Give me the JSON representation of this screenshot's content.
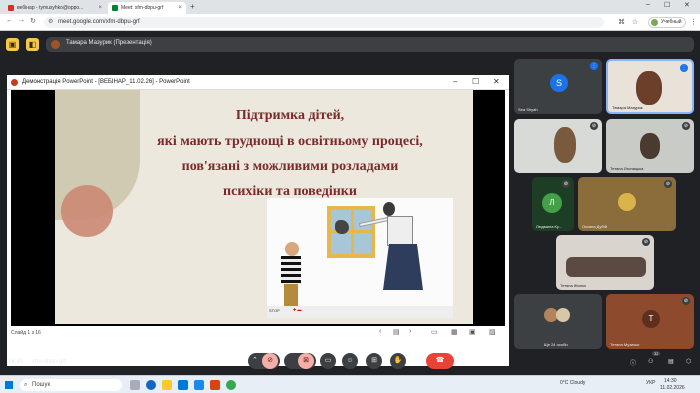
{
  "browser": {
    "tabs": [
      {
        "label": "вебінар - tymusyhko@oppo...",
        "active": false
      },
      {
        "label": "Meet: xfm-dbpu-grf",
        "active": true
      }
    ],
    "new_tab": "+",
    "url": "meet.google.com/xfm-dbpu-grf",
    "profile_label": "Учебный"
  },
  "meet": {
    "presenter_bar": "Тамара Мазурик (Презентація)",
    "meeting_time": "14:30",
    "meeting_code": "xfm-dbpu-grf",
    "participants_count": "32"
  },
  "powerpoint": {
    "window_title": "Демонстрація PowerPoint - [ВЕБІНАР_11.02.26] - PowerPoint",
    "slide_lines": [
      "Підтримка дітей,",
      "які мають труднощі в освітньому процесі,",
      "пов'язані з можливими розладами",
      "психіки та поведінки"
    ],
    "slide_counter": "Слайд 1 з 16",
    "illustration_caption": "STOP"
  },
  "participants": [
    {
      "name": "Sea Shyah",
      "initial": "S",
      "color": "#1a73e8"
    },
    {
      "name": "Тамара Мазурик",
      "initial": "",
      "color": "#e8e2d8"
    },
    {
      "name": "",
      "initial": "",
      "color": "#d8dad7"
    },
    {
      "name": "Тетяна Лєсницька",
      "initial": "",
      "color": "#c9cbc6"
    },
    {
      "name": "Людмила Ку...",
      "initial": "Л",
      "color": "#43a047"
    },
    {
      "name": "Оксана Дубій",
      "initial": "",
      "color": "#8a6d3b"
    },
    {
      "name": "Тетяна Жилко",
      "initial": "",
      "color": "#d9d4ce"
    },
    {
      "name": "Ще 24 особи",
      "initial": "",
      "color": "#3c4043"
    },
    {
      "name": "Тетяна Музичко",
      "initial": "Т",
      "color": "#8d4a2c"
    }
  ],
  "taskbar": {
    "search_placeholder": "Пошук",
    "weather": "0°C Cloudy",
    "lang": "УКР",
    "time": "14:30",
    "date": "11.02.2026"
  }
}
